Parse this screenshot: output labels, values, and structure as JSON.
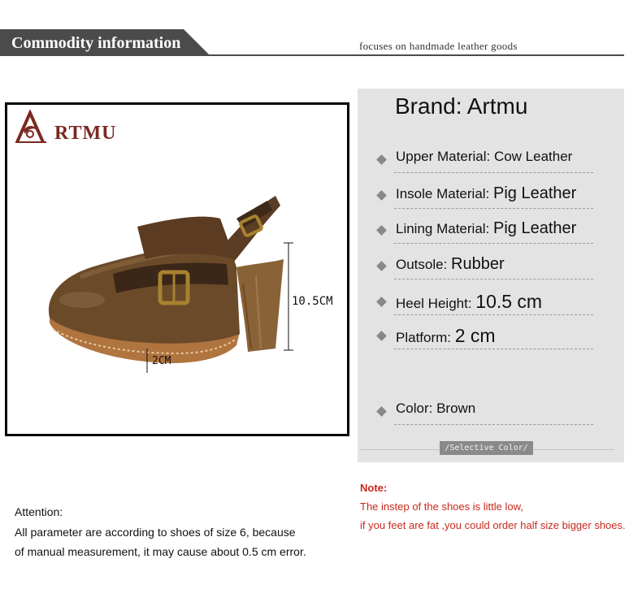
{
  "header": {
    "title": "Commodity information",
    "tagline": "focuses on handmade leather goods"
  },
  "product_image": {
    "logo_text": "RTMU",
    "heel_measure": "10.5CM",
    "platform_measure": "2CM"
  },
  "specs": {
    "brand": "Brand:  Artmu",
    "items": [
      {
        "label": "Upper Material: ",
        "value": "Cow Leather"
      },
      {
        "label": "Insole Material: ",
        "value": "Pig Leather"
      },
      {
        "label": "Lining Material: ",
        "value": "Pig Leather"
      },
      {
        "label": "Outsole: ",
        "value": "Rubber"
      },
      {
        "label": "Heel Height: ",
        "value": "10.5 cm"
      },
      {
        "label": "Platform: ",
        "value": "2 cm"
      },
      {
        "label": "Color:  ",
        "value": "Brown"
      }
    ],
    "selective_color": "/Selective Color/"
  },
  "note": {
    "heading": "Note:",
    "lines": [
      "The instep of the shoes is little low,",
      "if you feet are fat ,you could order half size bigger shoes."
    ]
  },
  "attention": {
    "heading": "Attention:",
    "lines": [
      "All parameter are according to shoes of size 6, because",
      "of manual measurement, it may cause about 0.5 cm error."
    ]
  },
  "colors": {
    "header_bar": "#4b4b4b",
    "note_red": "#c8281e",
    "spec_panel": "#e3e3e3",
    "logo_red": "#7a2a22",
    "leather_brown": "#6b4a2a"
  }
}
